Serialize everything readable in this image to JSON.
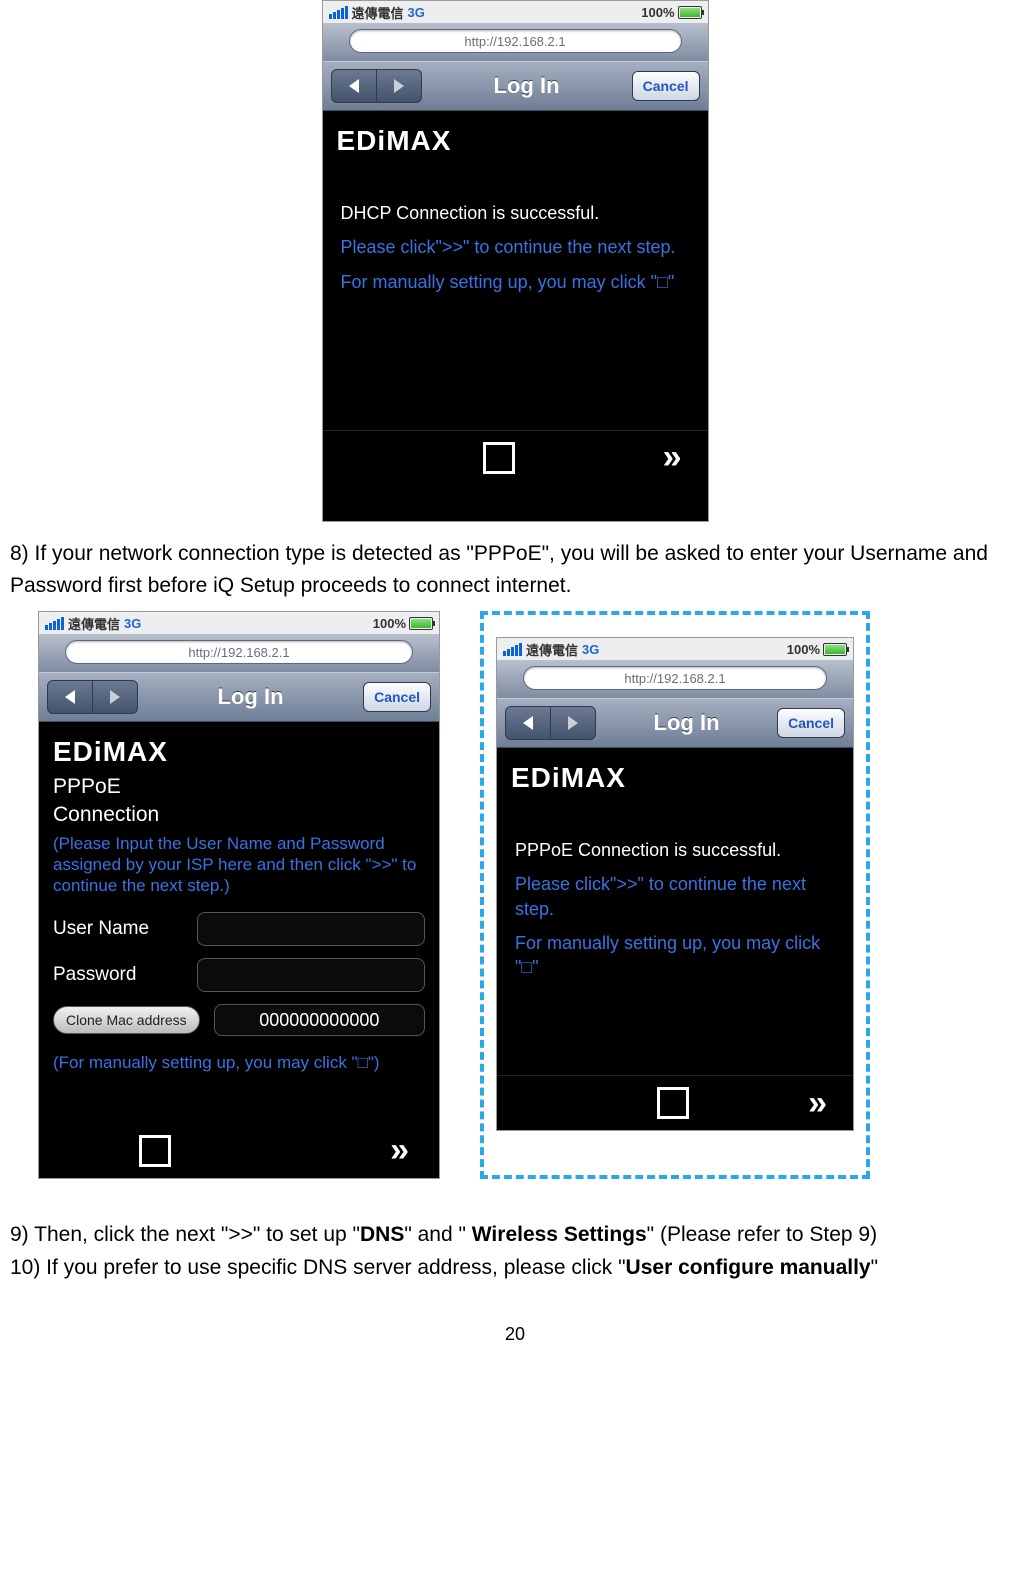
{
  "status": {
    "carrier": "遠傳電信",
    "network": "3G",
    "battery_pct": "100%"
  },
  "url": "http://192.168.2.1",
  "titlebar": {
    "title": "Log In",
    "cancel": "Cancel"
  },
  "logo": "EDIMAX",
  "screen1": {
    "heading": "DHCP Connection is successful.",
    "line1": "Please click\">>\" to continue the next step.",
    "line2": "For manually setting up, you may click \"□\""
  },
  "para8": "8) If your network connection type is detected as \"PPPoE\", you will be asked to enter your Username and Password first before iQ Setup proceeds to connect internet.",
  "screen2": {
    "heading1": "PPPoE",
    "heading2": "Connection",
    "hint": "(Please Input the User Name and Password assigned by your ISP here and then click \">>\" to continue the next step.)",
    "user_label": "User Name",
    "pwd_label": "Password",
    "clone_btn": "Clone Mac address",
    "mac_value": "000000000000",
    "bottom_hint": "(For manually setting up, you may click \"□\")"
  },
  "screen3": {
    "heading": "PPPoE Connection is successful.",
    "line1": "Please click\">>\" to continue the next step.",
    "line2": "For manually setting up, you may click \"□\""
  },
  "para9_a": "9) Then, click the next \">>\" to set up \"",
  "para9_dns": "DNS",
  "para9_b": "\" and \" ",
  "para9_ws": "Wireless Settings",
  "para9_c": "\" (Please refer to Step 9)",
  "para10_a": "10) If you prefer to use specific DNS server address, please click \"",
  "para10_u": "User configure manually",
  "para10_b": "\"",
  "page_number": "20"
}
